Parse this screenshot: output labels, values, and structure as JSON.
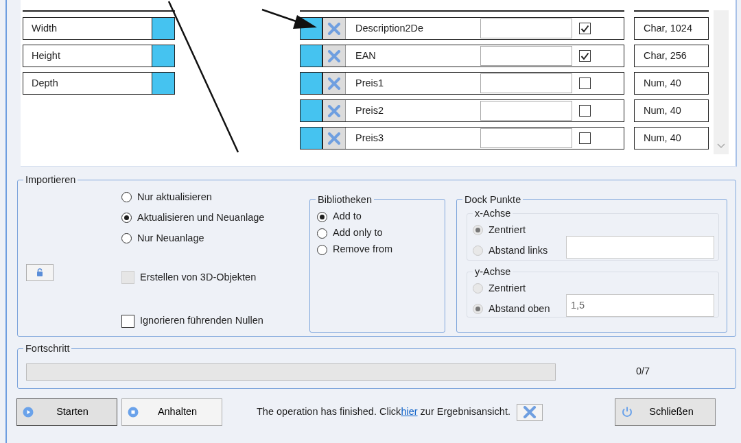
{
  "attribute_fields": [
    {
      "label": "Width"
    },
    {
      "label": "Height"
    },
    {
      "label": "Depth"
    }
  ],
  "mapping_rows": [
    {
      "name": "Description2De",
      "checked": true,
      "type": "Char, 1024"
    },
    {
      "name": "EAN",
      "checked": true,
      "type": "Char, 256"
    },
    {
      "name": "Preis1",
      "checked": false,
      "type": "Num, 40"
    },
    {
      "name": "Preis2",
      "checked": false,
      "type": "Num, 40"
    },
    {
      "name": "Preis3",
      "checked": false,
      "type": "Num, 40"
    }
  ],
  "import": {
    "title": "Importieren",
    "modes": [
      {
        "label": "Nur aktualisieren",
        "selected": false
      },
      {
        "label": "Aktualisieren und Neuanlage",
        "selected": true
      },
      {
        "label": "Nur Neuanlage",
        "selected": false
      }
    ],
    "options": [
      {
        "label": "Erstellen von 3D-Objekten",
        "checked": false,
        "disabled": true
      },
      {
        "label": "Ignorieren führenden Nullen",
        "checked": false,
        "disabled": false
      }
    ],
    "libraries": {
      "title": "Bibliotheken",
      "options": [
        {
          "label": "Add to",
          "selected": true
        },
        {
          "label": "Add only to",
          "selected": false
        },
        {
          "label": "Remove from",
          "selected": false
        }
      ]
    },
    "dock_points": {
      "title": "Dock Punkte",
      "axes": [
        {
          "title": "x-Achse",
          "disabled": true,
          "options": [
            {
              "label": "Zentriert",
              "selected": true
            },
            {
              "label": "Abstand links",
              "selected": false
            }
          ]
        },
        {
          "title": "y-Achse",
          "disabled": true,
          "options": [
            {
              "label": "Zentriert",
              "selected": false
            },
            {
              "label": "Abstand oben",
              "selected": true
            }
          ],
          "value": "1,5"
        }
      ]
    }
  },
  "progress": {
    "title": "Fortschritt",
    "level": 0,
    "reading": "0/7"
  },
  "footer": {
    "buttons": [
      {
        "label": "Starten",
        "kind": "start",
        "focused": true
      },
      {
        "label": "Anhalten",
        "kind": "stop",
        "focused": false
      }
    ],
    "status": {
      "before": "The operation has finished. Click",
      "link": "hier",
      "after": " zur Ergebnisansicht."
    },
    "close_button": {
      "label": "Schließen"
    }
  }
}
